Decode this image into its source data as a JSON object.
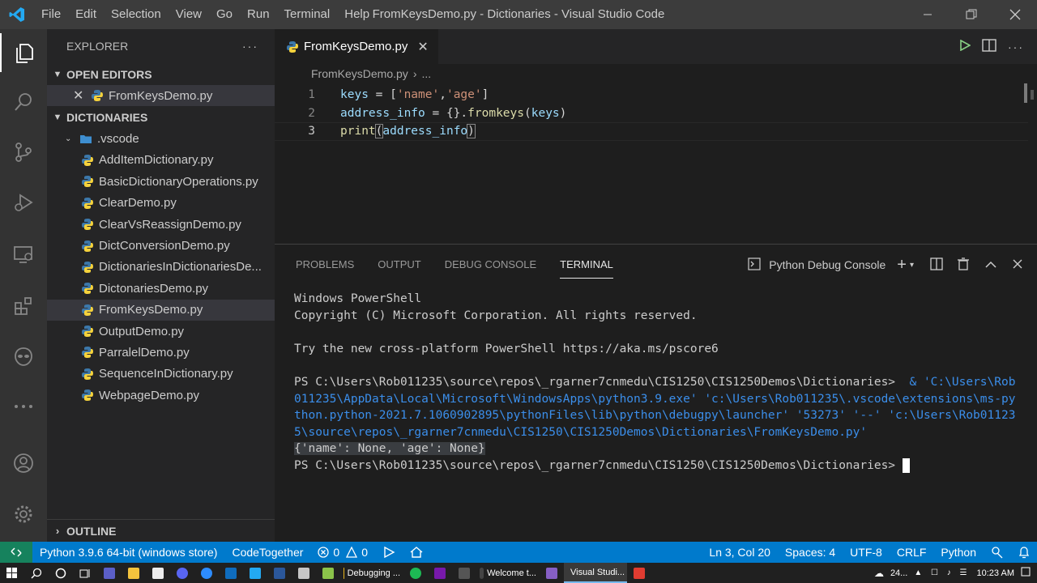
{
  "titlebar": {
    "title": "FromKeysDemo.py - Dictionaries - Visual Studio Code",
    "menu": [
      "File",
      "Edit",
      "Selection",
      "View",
      "Go",
      "Run",
      "Terminal",
      "Help"
    ]
  },
  "sidebar": {
    "header": "EXPLORER",
    "open_editors_label": "OPEN EDITORS",
    "open_editors": [
      "FromKeysDemo.py"
    ],
    "folder_label": "DICTIONARIES",
    "subfolder": ".vscode",
    "files": [
      "AddItemDictionary.py",
      "BasicDictionaryOperations.py",
      "ClearDemo.py",
      "ClearVsReassignDemo.py",
      "DictConversionDemo.py",
      "DictionariesInDictionariesDe...",
      "DictonariesDemo.py",
      "FromKeysDemo.py",
      "OutputDemo.py",
      "ParralelDemo.py",
      "SequenceInDictionary.py",
      "WebpageDemo.py"
    ],
    "selected_file": "FromKeysDemo.py",
    "outline_label": "OUTLINE"
  },
  "editor": {
    "tab_label": "FromKeysDemo.py",
    "breadcrumb_file": "FromKeysDemo.py",
    "breadcrumb_more": "...",
    "line_numbers": [
      "1",
      "2",
      "3"
    ],
    "code": [
      "keys = ['name','age']",
      "address_info = {}.fromkeys(keys)",
      "print(address_info)"
    ]
  },
  "panel": {
    "tabs": [
      "PROBLEMS",
      "OUTPUT",
      "DEBUG CONSOLE",
      "TERMINAL"
    ],
    "active_tab": "TERMINAL",
    "terminal_selector": "Python Debug Console",
    "terminal": {
      "line1": "Windows PowerShell",
      "line2": "Copyright (C) Microsoft Corporation. All rights reserved.",
      "line3": "",
      "line4": "Try the new cross-platform PowerShell https://aka.ms/pscore6",
      "line5": "",
      "prompt1": "PS C:\\Users\\Rob011235\\source\\repos\\_rgarner7cnmedu\\CIS1250\\CIS1250Demos\\Dictionaries> ",
      "cmd1": " & 'C:\\Users\\Rob",
      "cmd2": "011235\\AppData\\Local\\Microsoft\\WindowsApps\\python3.9.exe' 'c:\\Users\\Rob011235\\.vscode\\extensions\\ms-py",
      "cmd3": "thon.python-2021.7.1060902895\\pythonFiles\\lib\\python\\debugpy\\launcher' '53273' '--' 'c:\\Users\\Rob01123",
      "cmd4": "5\\source\\repos\\_rgarner7cnmedu\\CIS1250\\CIS1250Demos\\Dictionaries\\FromKeysDemo.py'",
      "output": "{'name': None, 'age': None}",
      "prompt2": "PS C:\\Users\\Rob011235\\source\\repos\\_rgarner7cnmedu\\CIS1250\\CIS1250Demos\\Dictionaries> "
    }
  },
  "statusbar": {
    "interpreter": "Python 3.9.6 64-bit (windows store)",
    "codetogether": "CodeTogether",
    "errors": "0",
    "warnings": "0",
    "position": "Ln 3, Col 20",
    "spaces": "Spaces: 4",
    "encoding": "UTF-8",
    "eol": "CRLF",
    "language": "Python"
  },
  "taskbar": {
    "apps": [
      "Debugging ...",
      "Welcome t...",
      "Visual Studi..."
    ],
    "tray_text": "24...",
    "clock": "10:23 AM"
  },
  "colors": {
    "accent": "#007acc",
    "activity_bar": "#333333",
    "sidebar": "#252526",
    "editor": "#1e1e1e"
  }
}
